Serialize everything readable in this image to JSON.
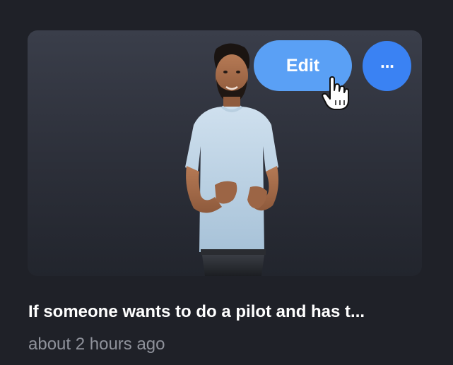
{
  "card": {
    "title": "If someone wants to do a pilot and has t...",
    "timestamp": "about 2 hours ago",
    "thumbnail_icon": "avatar-thumbnail"
  },
  "actions": {
    "edit_label": "Edit",
    "more_label": "···",
    "edit_color": "#5aa0f5",
    "more_color": "#3a82f3"
  },
  "cursor": {
    "icon": "hand-pointer-icon"
  }
}
